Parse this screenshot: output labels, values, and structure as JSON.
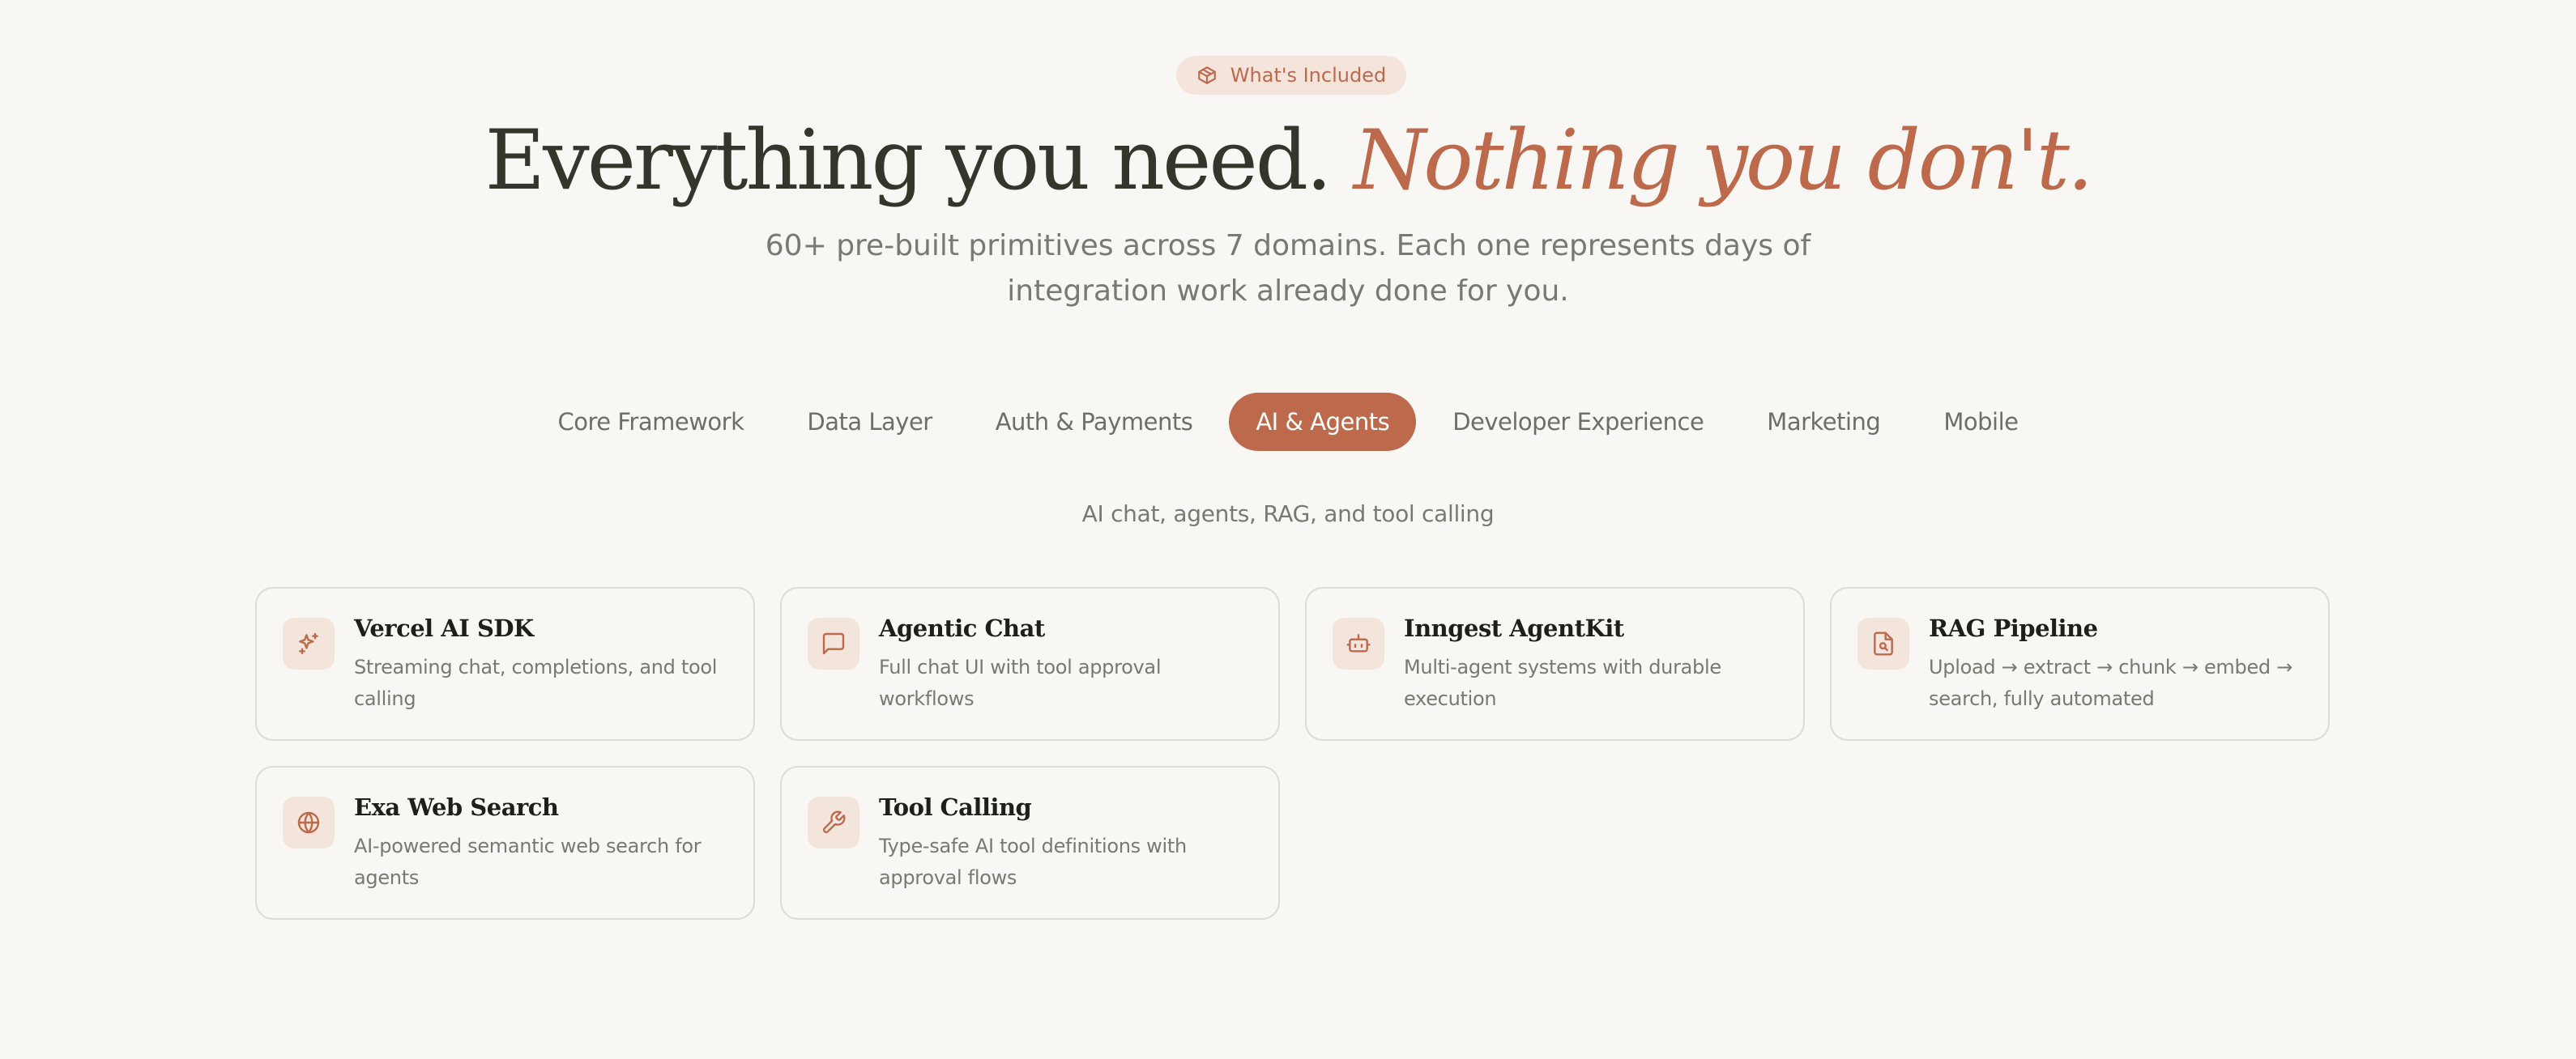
{
  "badge": {
    "label": "What's Included",
    "icon": "box-icon"
  },
  "hero": {
    "title_main": "Everything you need.",
    "title_accent": "Nothing you don't.",
    "subtitle": "60+ pre-built primitives across 7 domains. Each one represents days of integration work already done for you."
  },
  "tabs": [
    {
      "label": "Core Framework",
      "active": false
    },
    {
      "label": "Data Layer",
      "active": false
    },
    {
      "label": "Auth & Payments",
      "active": false
    },
    {
      "label": "AI & Agents",
      "active": true
    },
    {
      "label": "Developer Experience",
      "active": false
    },
    {
      "label": "Marketing",
      "active": false
    },
    {
      "label": "Mobile",
      "active": false
    }
  ],
  "domain_description": "AI chat, agents, RAG, and tool calling",
  "cards": [
    {
      "title": "Vercel AI SDK",
      "description": "Streaming chat, completions, and tool calling",
      "icon": "sparkles-icon"
    },
    {
      "title": "Agentic Chat",
      "description": "Full chat UI with tool approval workflows",
      "icon": "message-square-icon"
    },
    {
      "title": "Inngest AgentKit",
      "description": "Multi-agent systems with durable execution",
      "icon": "bot-icon"
    },
    {
      "title": "RAG Pipeline",
      "description": "Upload → extract → chunk → embed → search, fully automated",
      "icon": "file-search-icon"
    },
    {
      "title": "Exa Web Search",
      "description": "AI-powered semantic web search for agents",
      "icon": "globe-icon"
    },
    {
      "title": "Tool Calling",
      "description": "Type-safe AI tool definitions with approval flows",
      "icon": "wrench-icon"
    }
  ],
  "colors": {
    "accent": "#bd6a4c",
    "background": "#f9f7f3",
    "icon_background": "#f3e4dc",
    "heading": "#35352b",
    "muted_text": "#7a7870",
    "card_border": "#dddbd5"
  }
}
